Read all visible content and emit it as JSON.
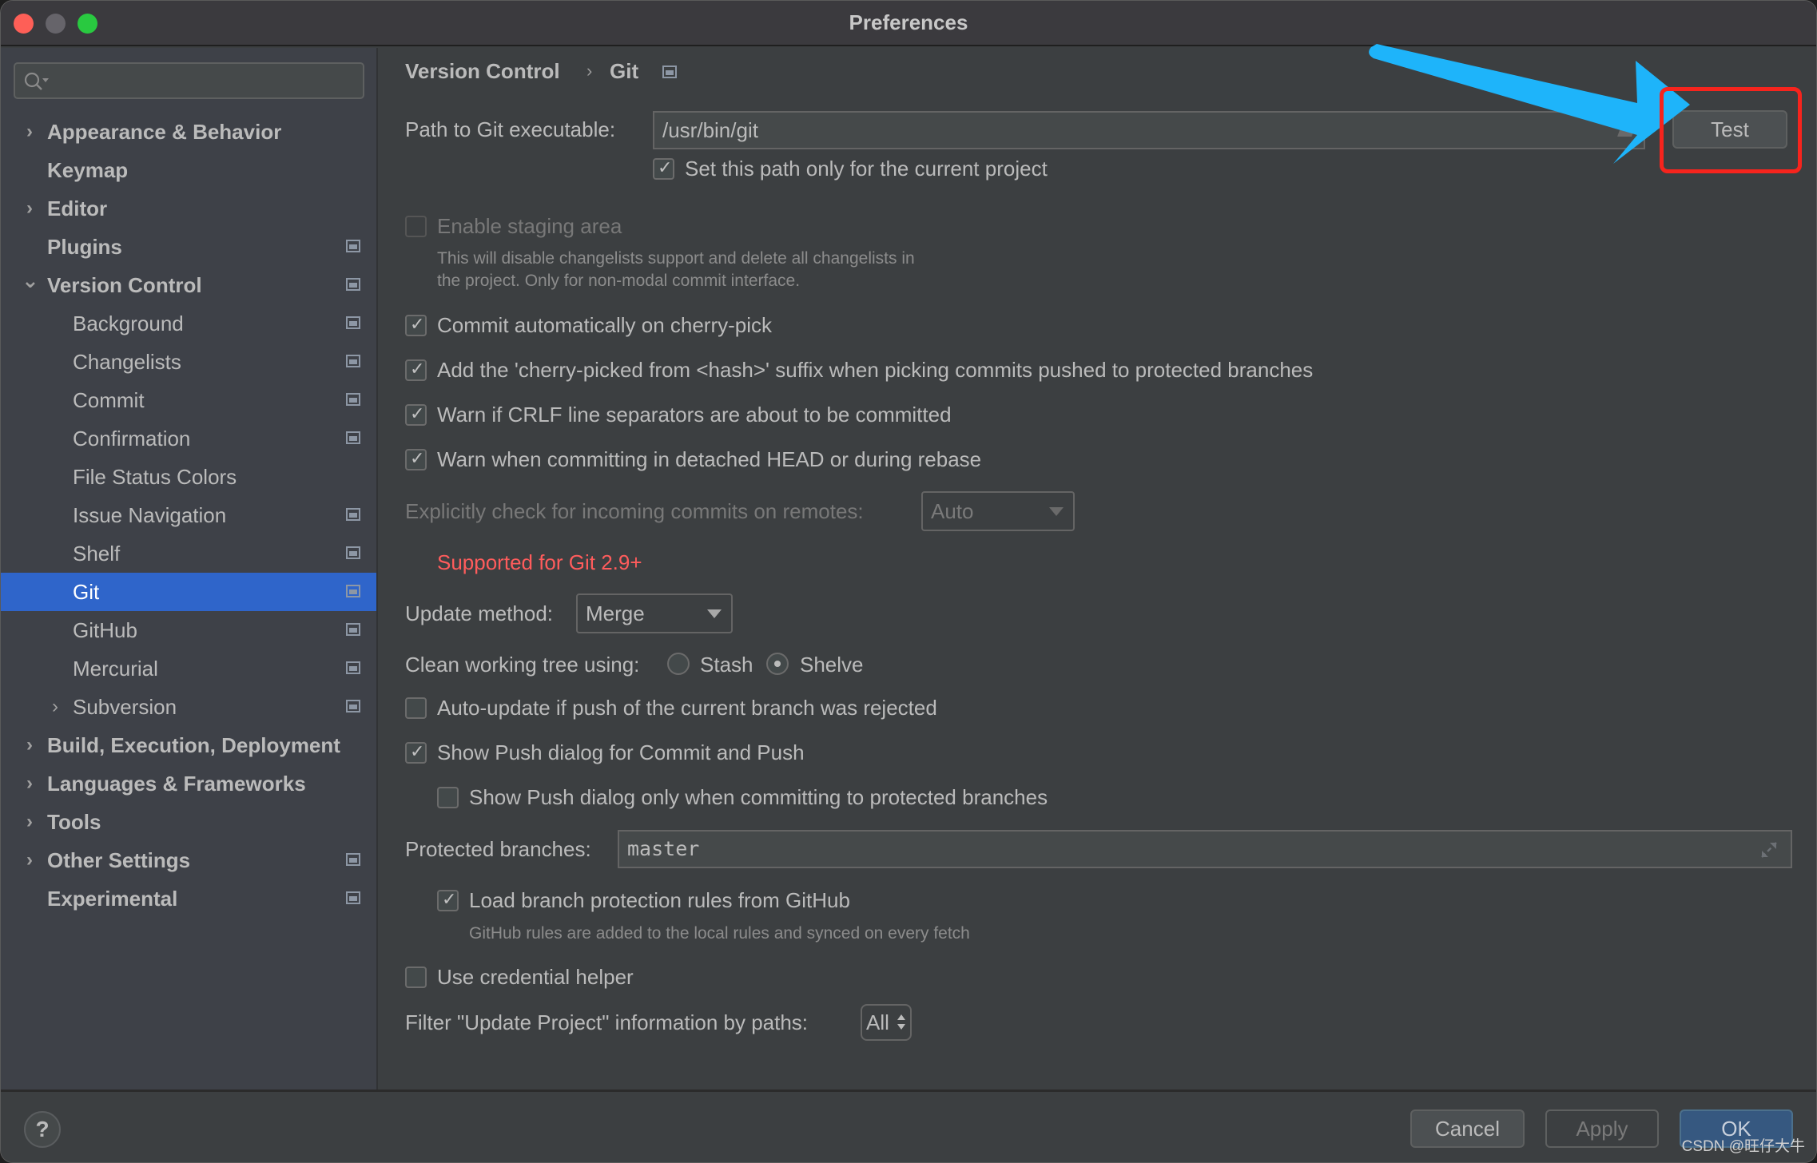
{
  "window": {
    "title": "Preferences"
  },
  "sidebar": {
    "search": {
      "placeholder": "",
      "value": ""
    },
    "items": [
      {
        "label": "Appearance & Behavior",
        "level": 0,
        "bold": true,
        "expandable": true,
        "expanded": false,
        "project_icon": false
      },
      {
        "label": "Keymap",
        "level": 0,
        "bold": true,
        "expandable": false,
        "project_icon": false
      },
      {
        "label": "Editor",
        "level": 0,
        "bold": true,
        "expandable": true,
        "expanded": false,
        "project_icon": false
      },
      {
        "label": "Plugins",
        "level": 0,
        "bold": true,
        "expandable": false,
        "project_icon": true
      },
      {
        "label": "Version Control",
        "level": 0,
        "bold": true,
        "expandable": true,
        "expanded": true,
        "project_icon": true
      },
      {
        "label": "Background",
        "level": 1,
        "bold": false,
        "expandable": false,
        "project_icon": true
      },
      {
        "label": "Changelists",
        "level": 1,
        "bold": false,
        "expandable": false,
        "project_icon": true
      },
      {
        "label": "Commit",
        "level": 1,
        "bold": false,
        "expandable": false,
        "project_icon": true
      },
      {
        "label": "Confirmation",
        "level": 1,
        "bold": false,
        "expandable": false,
        "project_icon": true
      },
      {
        "label": "File Status Colors",
        "level": 1,
        "bold": false,
        "expandable": false,
        "project_icon": false
      },
      {
        "label": "Issue Navigation",
        "level": 1,
        "bold": false,
        "expandable": false,
        "project_icon": true
      },
      {
        "label": "Shelf",
        "level": 1,
        "bold": false,
        "expandable": false,
        "project_icon": true
      },
      {
        "label": "Git",
        "level": 1,
        "bold": false,
        "expandable": false,
        "project_icon": true,
        "selected": true
      },
      {
        "label": "GitHub",
        "level": 1,
        "bold": false,
        "expandable": false,
        "project_icon": true
      },
      {
        "label": "Mercurial",
        "level": 1,
        "bold": false,
        "expandable": false,
        "project_icon": true
      },
      {
        "label": "Subversion",
        "level": 1,
        "bold": false,
        "expandable": true,
        "expanded": false,
        "project_icon": true
      },
      {
        "label": "Build, Execution, Deployment",
        "level": 0,
        "bold": true,
        "expandable": true,
        "expanded": false,
        "project_icon": false
      },
      {
        "label": "Languages & Frameworks",
        "level": 0,
        "bold": true,
        "expandable": true,
        "expanded": false,
        "project_icon": false
      },
      {
        "label": "Tools",
        "level": 0,
        "bold": true,
        "expandable": true,
        "expanded": false,
        "project_icon": false
      },
      {
        "label": "Other Settings",
        "level": 0,
        "bold": true,
        "expandable": true,
        "expanded": false,
        "project_icon": true
      },
      {
        "label": "Experimental",
        "level": 0,
        "bold": true,
        "expandable": false,
        "project_icon": true
      }
    ]
  },
  "breadcrumb": {
    "parent": "Version Control",
    "separator": "›",
    "current": "Git"
  },
  "git": {
    "path_label": "Path to Git executable:",
    "path_value": "/usr/bin/git",
    "test_button": "Test",
    "path_project_only": {
      "label": "Set this path only for the current project",
      "checked": true
    },
    "staging_area": {
      "label": "Enable staging area",
      "checked": false,
      "disabled": true,
      "hint_line1": "This will disable changelists support and delete all changelists in",
      "hint_line2": "the project. Only for non-modal commit interface."
    },
    "options": [
      {
        "label": "Commit automatically on cherry-pick",
        "checked": true
      },
      {
        "label": "Add the 'cherry-picked from <hash>' suffix when picking commits pushed to protected branches",
        "checked": true
      },
      {
        "label": "Warn if CRLF line separators are about to be committed",
        "checked": true
      },
      {
        "label": "Warn when committing in detached HEAD or during rebase",
        "checked": true
      }
    ],
    "incoming_check": {
      "label": "Explicitly check for incoming commits on remotes:",
      "value": "Auto",
      "disabled": true
    },
    "incoming_error": "Supported for Git 2.9+",
    "update_method": {
      "label": "Update method:",
      "value": "Merge"
    },
    "clean_tree": {
      "label": "Clean working tree using:",
      "options": [
        "Stash",
        "Shelve"
      ],
      "selected": "Shelve"
    },
    "auto_update": {
      "label": "Auto-update if push of the current branch was rejected",
      "checked": false
    },
    "show_push": {
      "label": "Show Push dialog for Commit and Push",
      "checked": true
    },
    "show_push_protected": {
      "label": "Show Push dialog only when committing to protected branches",
      "checked": false
    },
    "protected_branches": {
      "label": "Protected branches:",
      "value": "master"
    },
    "load_rules": {
      "label": "Load branch protection rules from GitHub",
      "checked": true,
      "hint": "GitHub rules are added to the local rules and synced on every fetch"
    },
    "credential_helper": {
      "label": "Use credential helper",
      "checked": false
    },
    "filter_paths": {
      "label": "Filter \"Update Project\" information by paths:",
      "value": "All"
    }
  },
  "footer": {
    "help": "?",
    "cancel": "Cancel",
    "apply": "Apply",
    "ok": "OK"
  },
  "annotation": {
    "arrow_color": "#1eb4fa",
    "box_color": "#f6241d",
    "watermark": "CSDN @旺仔大牛"
  }
}
